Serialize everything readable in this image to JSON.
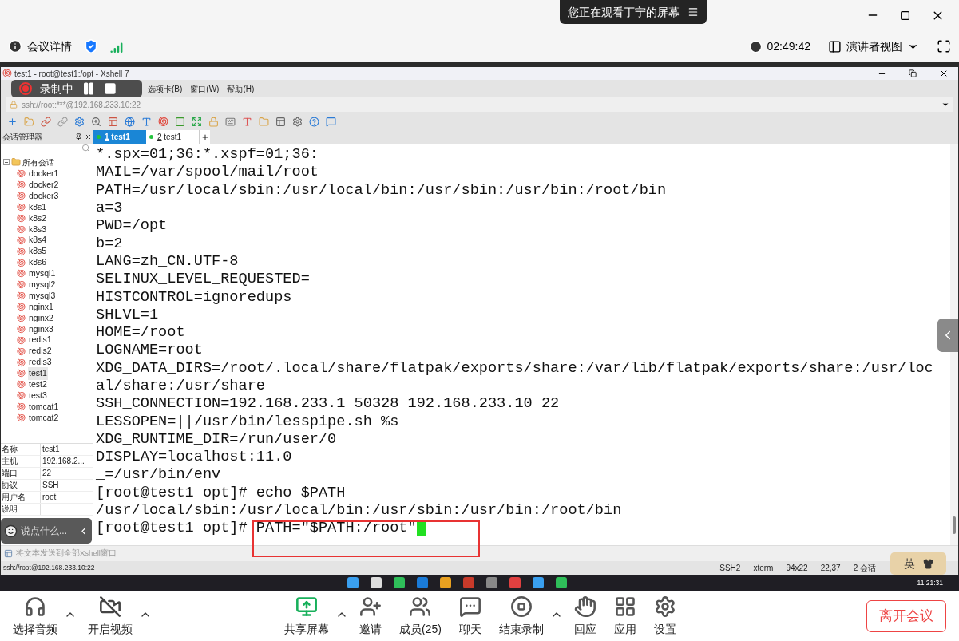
{
  "viewer_banner": {
    "text": "您正在观看丁宁的屏幕"
  },
  "meeting_bar": {
    "details": "会议详情",
    "timer": "02:49:42",
    "view_mode": "演讲者视图"
  },
  "recording": {
    "label": "录制中"
  },
  "xshell": {
    "title": "test1 - root@test1:/opt - Xshell 7",
    "menu": [
      "选项卡(B)",
      "窗口(W)",
      "帮助(H)"
    ],
    "address": "ssh://root:***@192.168.233.10:22",
    "session_manager": {
      "title": "会话管理器",
      "tree": {
        "label": "所有会话",
        "expanded": true,
        "children": [
          {
            "label": "docker1",
            "selected": false
          },
          {
            "label": "docker2",
            "selected": false
          },
          {
            "label": "docker3",
            "selected": false
          },
          {
            "label": "k8s1",
            "selected": false
          },
          {
            "label": "k8s2",
            "selected": false
          },
          {
            "label": "k8s3",
            "selected": false
          },
          {
            "label": "k8s4",
            "selected": false
          },
          {
            "label": "k8s5",
            "selected": false
          },
          {
            "label": "k8s6",
            "selected": false
          },
          {
            "label": "mysql1",
            "selected": false
          },
          {
            "label": "mysql2",
            "selected": false
          },
          {
            "label": "mysql3",
            "selected": false
          },
          {
            "label": "nginx1",
            "selected": false
          },
          {
            "label": "nginx2",
            "selected": false
          },
          {
            "label": "nginx3",
            "selected": false
          },
          {
            "label": "redis1",
            "selected": false
          },
          {
            "label": "redis2",
            "selected": false
          },
          {
            "label": "redis3",
            "selected": false
          },
          {
            "label": "test1",
            "selected": true
          },
          {
            "label": "test2",
            "selected": false
          },
          {
            "label": "test3",
            "selected": false
          },
          {
            "label": "tomcat1",
            "selected": false
          },
          {
            "label": "tomcat2",
            "selected": false
          }
        ]
      }
    },
    "properties": [
      {
        "name": "名称",
        "value": "test1"
      },
      {
        "name": "主机",
        "value": "192.168.2..."
      },
      {
        "name": "端口",
        "value": "22"
      },
      {
        "name": "协议",
        "value": "SSH"
      },
      {
        "name": "用户名",
        "value": "root"
      },
      {
        "name": "说明"
      }
    ],
    "tabs": [
      {
        "number": "1",
        "label": "test1",
        "selected": true
      },
      {
        "number": "2",
        "label": "test1",
        "selected": false
      }
    ],
    "terminal_lines": [
      "*.spx=01;36:*.xspf=01;36:",
      "MAIL=/var/spool/mail/root",
      "PATH=/usr/local/sbin:/usr/local/bin:/usr/sbin:/usr/bin:/root/bin",
      "a=3",
      "PWD=/opt",
      "b=2",
      "LANG=zh_CN.UTF-8",
      "SELINUX_LEVEL_REQUESTED=",
      "HISTCONTROL=ignoredups",
      "SHLVL=1",
      "HOME=/root",
      "LOGNAME=root",
      "XDG_DATA_DIRS=/root/.local/share/flatpak/exports/share:/var/lib/flatpak/exports/share:/usr/loc",
      "al/share:/usr/share",
      "SSH_CONNECTION=192.168.233.1 50328 192.168.233.10 22",
      "LESSOPEN=||/usr/bin/lesspipe.sh %s",
      "XDG_RUNTIME_DIR=/run/user/0",
      "DISPLAY=localhost:11.0",
      "_=/usr/bin/env",
      "[root@test1 opt]# echo $PATH",
      "/usr/local/sbin:/usr/local/bin:/usr/sbin:/usr/bin:/root/bin",
      "[root@test1 opt]# PATH=\"$PATH:/root\""
    ],
    "cursor_visible": true,
    "send_bar": "将文本发送到全部Xshell窗口",
    "status": {
      "address": "ssh://root@192.168.233.10:22",
      "items": [
        "SSH2",
        "xterm",
        "94x22",
        "22,37",
        "2 会话"
      ]
    }
  },
  "ime": {
    "label": "英"
  },
  "chat": {
    "placeholder": "说点什么..."
  },
  "taskbar": {
    "time": "11:21:31"
  },
  "toolbar": [
    {
      "kind": "audio",
      "label": "选择音频",
      "has_menu": true
    },
    {
      "kind": "video",
      "label": "开启视频",
      "has_menu": true
    },
    {
      "kind": "share",
      "label": "共享屏幕",
      "has_menu": true
    },
    {
      "kind": "invite",
      "label": "邀请",
      "has_menu": false
    },
    {
      "kind": "members",
      "label": "成员(25)",
      "has_menu": false
    },
    {
      "kind": "chat",
      "label": "聊天",
      "has_menu": false
    },
    {
      "kind": "record",
      "label": "结束录制",
      "has_menu": true
    },
    {
      "kind": "react",
      "label": "回应",
      "has_menu": false
    },
    {
      "kind": "apps",
      "label": "应用",
      "has_menu": false
    },
    {
      "kind": "settings",
      "label": "设置",
      "has_menu": false
    }
  ],
  "leave_button": {
    "label": "离开会议"
  }
}
